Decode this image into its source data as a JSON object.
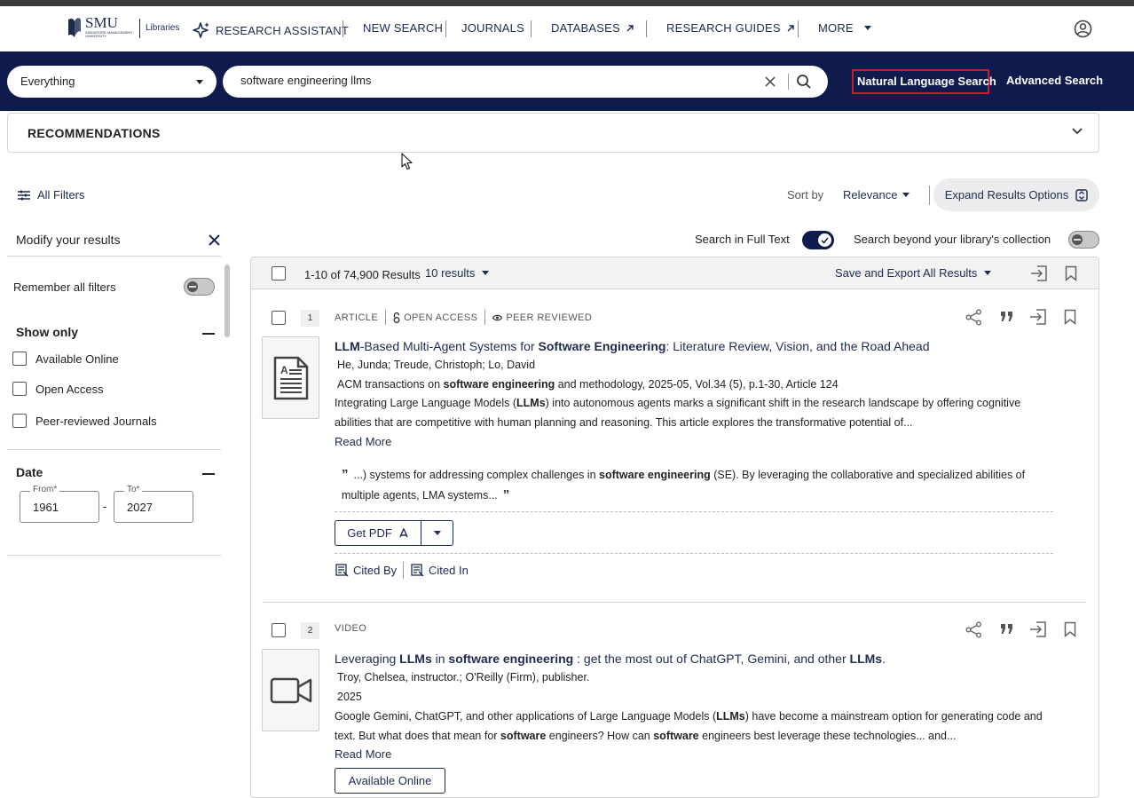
{
  "nav": {
    "logo_text": "SMU",
    "logo_sub": "Libraries",
    "items": [
      {
        "label": "RESEARCH ASSISTANT"
      },
      {
        "label": "NEW SEARCH"
      },
      {
        "label": "JOURNALS"
      },
      {
        "label": "DATABASES"
      },
      {
        "label": "RESEARCH GUIDES"
      },
      {
        "label": "MORE"
      }
    ]
  },
  "search": {
    "scope": "Everything",
    "query": "software engineering llms",
    "natural_language": "Natural Language Search",
    "advanced": "Advanced Search"
  },
  "recommendations": {
    "label": "RECOMMENDATIONS"
  },
  "toolbar": {
    "all_filters": "All Filters",
    "sort_by": "Sort by",
    "sort_value": "Relevance",
    "expand": "Expand Results Options",
    "full_text": "Search in Full Text",
    "beyond": "Search beyond your library's collection"
  },
  "filters": {
    "title": "Modify your results",
    "remember": "Remember all filters",
    "show_only": "Show only",
    "options": [
      "Available Online",
      "Open Access",
      "Peer-reviewed Journals"
    ],
    "date_title": "Date",
    "from_label": "From*",
    "from_value": "1961",
    "to_label": "To*",
    "to_value": "2027",
    "date_dash": "-"
  },
  "results": {
    "count": "1-10 of 74,900 Results",
    "per_page": "10 results",
    "save_export": "Save and Export All Results",
    "items": [
      {
        "rank": "1",
        "type": "ARTICLE",
        "open_access": "OPEN ACCESS",
        "peer_reviewed": "PEER REVIEWED",
        "title_parts": [
          [
            "LLM",
            true
          ],
          [
            "-Based Multi-Agent Systems for ",
            false
          ],
          [
            "Software Engineering",
            true
          ],
          [
            ": Literature Review, Vision, and the Road Ahead",
            false
          ]
        ],
        "authors": "He, Junda; Treude, Christoph; Lo, David",
        "source_parts": [
          [
            "ACM transactions on ",
            false
          ],
          [
            "software engineering",
            true
          ],
          [
            " and methodology, 2025-05, Vol.34 (5), p.1-30, Article 124",
            false
          ]
        ],
        "desc_parts": [
          [
            "Integrating Large Language Models (",
            false
          ],
          [
            "LLMs",
            true
          ],
          [
            ") into autonomous agents marks a significant shift in the research landscape by offering cognitive abilities that are competitive with human planning and reasoning. This article explores the transformative potential of...",
            false
          ]
        ],
        "read_more": "Read More",
        "snippet_parts": [
          [
            "...) systems for addressing complex challenges in ",
            false
          ],
          [
            "software engineering",
            true
          ],
          [
            " (SE). By leveraging the collaborative and specialized abilities of multiple agents, LMA systems...",
            false
          ]
        ],
        "get_pdf": "Get PDF",
        "cited_by": "Cited By",
        "cited_in": "Cited In"
      },
      {
        "rank": "2",
        "type": "VIDEO",
        "title_parts": [
          [
            "Leveraging ",
            false
          ],
          [
            "LLMs",
            true
          ],
          [
            " in ",
            false
          ],
          [
            "software engineering",
            true
          ],
          [
            " : get the most out of ChatGPT, Gemini, and other ",
            false
          ],
          [
            "LLMs",
            true
          ],
          [
            ".",
            false
          ]
        ],
        "authors": "Troy, Chelsea, instructor.; O'Reilly (Firm), publisher.",
        "source": "2025",
        "desc_parts": [
          [
            "Google Gemini, ChatGPT, and other applications of Large Language Models (",
            false
          ],
          [
            "LLMs",
            true
          ],
          [
            ") have become a mainstream option for generating code and text. But what does that mean for ",
            false
          ],
          [
            "software",
            true
          ],
          [
            " engineers? How can ",
            false
          ],
          [
            "software",
            true
          ],
          [
            " engineers best leverage these technologies... and...",
            false
          ]
        ],
        "read_more": "Read More",
        "available_online": "Available Online"
      }
    ]
  }
}
